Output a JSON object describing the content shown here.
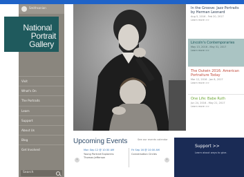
{
  "brand": {
    "smithsonian": "Smithsonian",
    "logo_lines": [
      "National",
      "Portrait",
      "Gallery"
    ]
  },
  "nav": {
    "items": [
      "Visit",
      "What's On",
      "The Portraits",
      "Learn",
      "Support",
      "About Us",
      "Blog",
      "Get Involved"
    ],
    "search_label": "Search"
  },
  "events": {
    "title": "Upcoming Events",
    "calendar_link": "See our events calendar",
    "items": [
      {
        "date": "Mon Sep 12 @ 10:30 AM",
        "name_1": "Young Portrait Explorers:",
        "name_2": "Thomas Jefferson"
      },
      {
        "date": "Fri Sep 16 @ 10:00 AM",
        "name_1": "Conversation Circles",
        "name_2": ""
      }
    ]
  },
  "exhibitions": [
    {
      "title": "In the Groove: Jazz Portraits by Herman Leonard",
      "dates": "Aug 5, 2016 - Feb 20, 2017",
      "more": "Learn more >>"
    },
    {
      "title": "Lincoln's Contemporaries",
      "dates": "May 13, 2016 - May 31, 2017",
      "more": "Learn more >>"
    },
    {
      "title": "The Outwin 2016: American Portraiture Today",
      "dates": "Mar 12, 2016 - Jan 8, 2017",
      "more": "Learn more >>"
    },
    {
      "title": "One Life: Babe Ruth",
      "dates": "Jun 24, 2016 - May 21, 2017",
      "more": "Learn more >>"
    }
  ],
  "support_box": {
    "title": "Support >>",
    "desc": "Learn about ways to give."
  },
  "colors": {
    "top_bar": "#1f63c8",
    "sidebar": "#8a867e",
    "logo_bg": "#1f5a5d",
    "support_bg": "#1a2b55"
  }
}
